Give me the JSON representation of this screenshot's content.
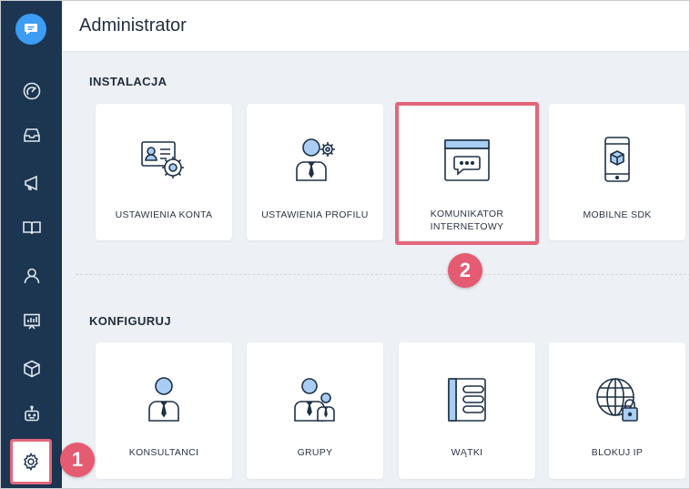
{
  "header": {
    "title": "Administrator"
  },
  "sidebar": {
    "items": [
      {
        "icon": "chat-logo-icon"
      },
      {
        "icon": "speedometer-icon"
      },
      {
        "icon": "inbox-icon"
      },
      {
        "icon": "megaphone-icon"
      },
      {
        "icon": "book-icon"
      },
      {
        "icon": "user-icon"
      },
      {
        "icon": "presentation-chart-icon"
      },
      {
        "icon": "box-icon"
      },
      {
        "icon": "bot-icon"
      },
      {
        "icon": "gear-icon"
      }
    ]
  },
  "sections": {
    "install": {
      "title": "INSTALACJA",
      "cards": [
        {
          "label": "USTAWIENIA KONTA"
        },
        {
          "label": "USTAWIENIA PROFILU"
        },
        {
          "label": "KOMUNIKATOR INTERNETOWY"
        },
        {
          "label": "MOBILNE SDK"
        }
      ]
    },
    "configure": {
      "title": "KONFIGURUJ",
      "cards": [
        {
          "label": "KONSULTANCI"
        },
        {
          "label": "GRUPY"
        },
        {
          "label": "WĄTKI"
        },
        {
          "label": "BLOKUJ IP"
        }
      ]
    }
  },
  "annotations": {
    "step1": "1",
    "step2": "2"
  },
  "colors": {
    "sidebar": "#1c3550",
    "accent": "#3d9cf4",
    "highlight": "#e3667c",
    "icon_fill": "#a9cdf3",
    "icon_stroke": "#1e3146"
  }
}
